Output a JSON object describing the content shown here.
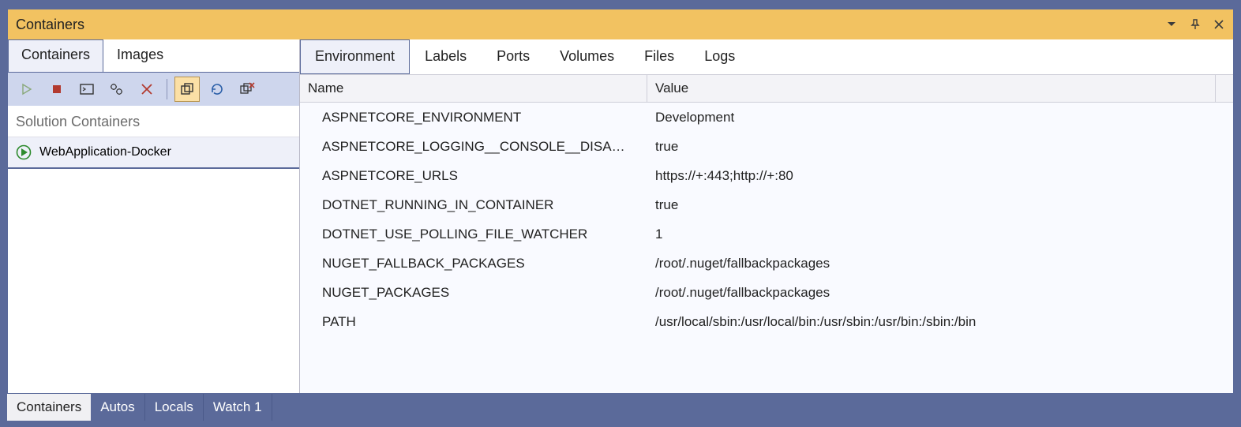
{
  "titlebar": {
    "title": "Containers"
  },
  "left": {
    "tabs": [
      {
        "label": "Containers",
        "active": true
      },
      {
        "label": "Images",
        "active": false
      }
    ],
    "section_label": "Solution Containers",
    "containers": [
      {
        "name": "WebApplication-Docker",
        "running": true
      }
    ]
  },
  "right": {
    "tabs": [
      {
        "label": "Environment",
        "active": true
      },
      {
        "label": "Labels",
        "active": false
      },
      {
        "label": "Ports",
        "active": false
      },
      {
        "label": "Volumes",
        "active": false
      },
      {
        "label": "Files",
        "active": false
      },
      {
        "label": "Logs",
        "active": false
      }
    ],
    "columns": {
      "name": "Name",
      "value": "Value"
    },
    "rows": [
      {
        "name": "ASPNETCORE_ENVIRONMENT",
        "value": "Development"
      },
      {
        "name": "ASPNETCORE_LOGGING__CONSOLE__DISABLECOLORS",
        "value": "true"
      },
      {
        "name": "ASPNETCORE_URLS",
        "value": "https://+:443;http://+:80"
      },
      {
        "name": "DOTNET_RUNNING_IN_CONTAINER",
        "value": "true"
      },
      {
        "name": "DOTNET_USE_POLLING_FILE_WATCHER",
        "value": "1"
      },
      {
        "name": "NUGET_FALLBACK_PACKAGES",
        "value": "/root/.nuget/fallbackpackages"
      },
      {
        "name": "NUGET_PACKAGES",
        "value": "/root/.nuget/fallbackpackages"
      },
      {
        "name": "PATH",
        "value": "/usr/local/sbin:/usr/local/bin:/usr/sbin:/usr/bin:/sbin:/bin"
      }
    ]
  },
  "bottom_tabs": [
    {
      "label": "Containers",
      "active": true
    },
    {
      "label": "Autos",
      "active": false
    },
    {
      "label": "Locals",
      "active": false
    },
    {
      "label": "Watch 1",
      "active": false
    }
  ]
}
